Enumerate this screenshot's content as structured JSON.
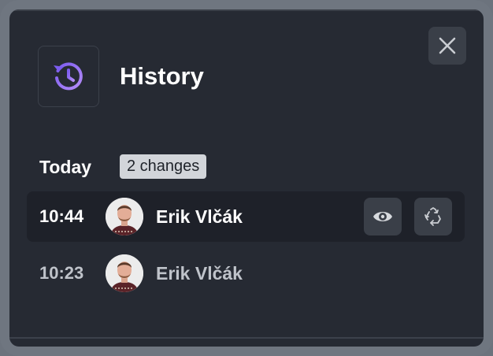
{
  "modal": {
    "title": "History",
    "header_icon": "history-icon",
    "close_icon": "close-icon"
  },
  "section": {
    "label": "Today",
    "badge": "2 changes"
  },
  "entries": [
    {
      "time": "10:44",
      "user": "Erik Vlčák",
      "active": true,
      "actions": [
        "eye-icon",
        "recycle-icon"
      ]
    },
    {
      "time": "10:23",
      "user": "Erik Vlčák",
      "active": false
    }
  ],
  "colors": {
    "accent": "#9a6bf5",
    "surface": "#262a33",
    "row_highlight": "#1e2129",
    "button": "#3a3f48"
  }
}
